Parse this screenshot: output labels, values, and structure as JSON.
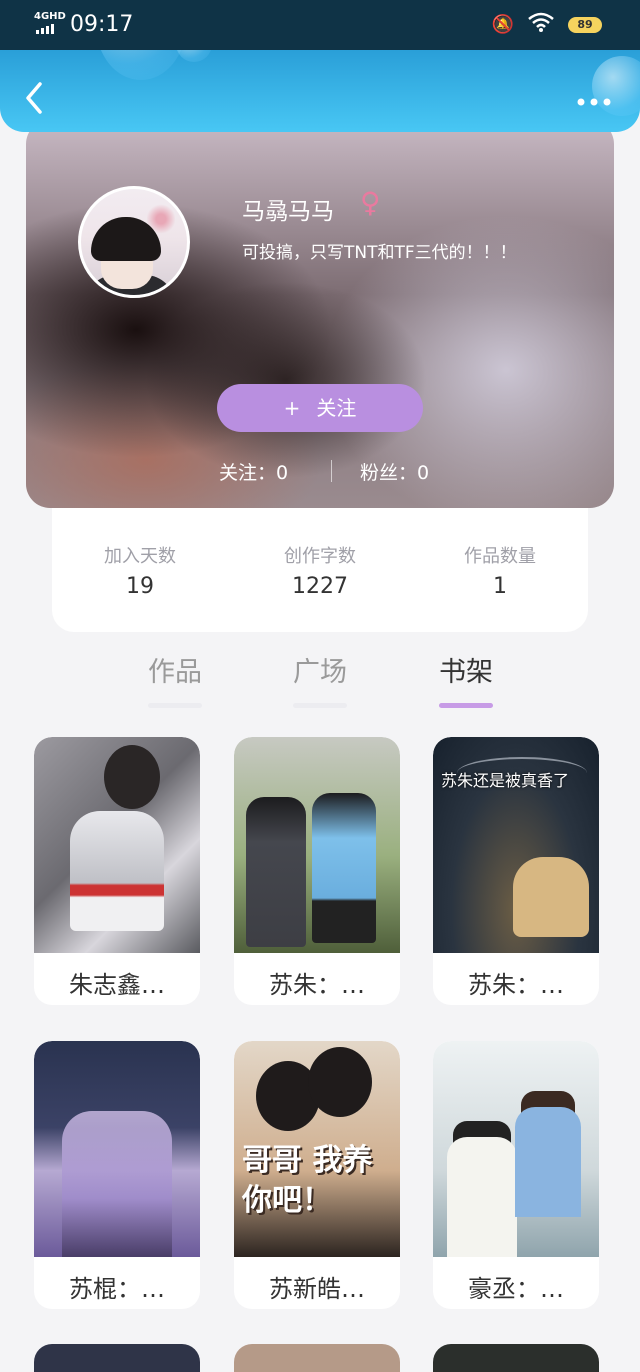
{
  "status_bar": {
    "network": "4GHD",
    "time": "09:17",
    "battery": "89",
    "icons": [
      "mute-icon",
      "wifi-icon",
      "battery-icon"
    ]
  },
  "header": {
    "back_icon": "chevron-left-icon",
    "more_icon": "more-dots-icon"
  },
  "profile": {
    "username": "马骉马马",
    "gender_symbol": "♀",
    "bio": "可投搞，只写TNT和TF三代的！！！",
    "follow_plus": "+",
    "follow_label": "关注",
    "following": "关注：0",
    "fans": "粉丝：0"
  },
  "stats": [
    {
      "label": "加入天数",
      "value": "19"
    },
    {
      "label": "创作字数",
      "value": "1227"
    },
    {
      "label": "作品数量",
      "value": "1"
    }
  ],
  "tabs": [
    {
      "label": "作品",
      "active": false
    },
    {
      "label": "广场",
      "active": false
    },
    {
      "label": "书架",
      "active": true
    }
  ],
  "books": [
    {
      "title": "朱志鑫…",
      "cover_text": ""
    },
    {
      "title": "苏朱：…",
      "cover_text": ""
    },
    {
      "title": "苏朱：…",
      "cover_text": "苏朱还是被真香了"
    },
    {
      "title": "苏棍：…",
      "cover_text": ""
    },
    {
      "title": "苏新皓…",
      "cover_text": "哥哥 我养你吧！"
    },
    {
      "title": "豪丞：…",
      "cover_text": ""
    }
  ],
  "colors": {
    "header_blue": "#2a9fd8",
    "accent_purple": "#b98fe0",
    "tab_active_underline": "#c79be6",
    "gender_pink": "#e97a9f"
  }
}
